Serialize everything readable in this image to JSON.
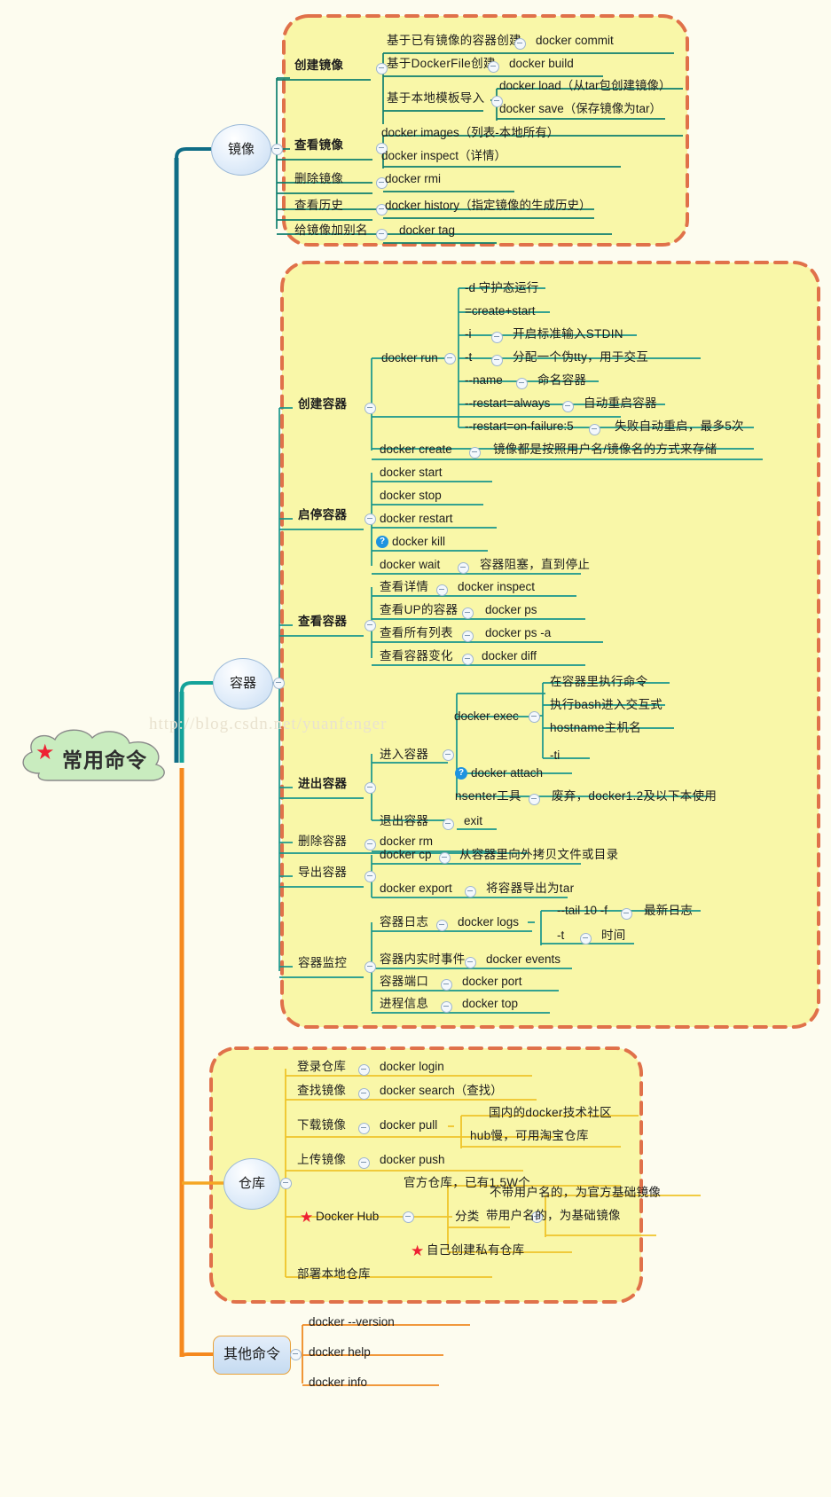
{
  "watermark": "http://blog.csdn.net/yuanfenger",
  "colors": {
    "canvas_bg": "#fdfcef",
    "group_fill": "#f9f7a8",
    "group_outline": "#e0714a",
    "branch_images": "#0f6d86",
    "branch_containers": "#14a39a",
    "branch_repo": "#f5a623",
    "branch_other": "#f5891e",
    "line_images": "#0f7f6f",
    "line_repo": "#efc42a",
    "line_other": "#ef8a22",
    "star": "#ee2233",
    "note_marker": "#1e93e0",
    "ellipse_fill": "#d5e6f7"
  },
  "root": {
    "label": "常用命令",
    "icon": "star-icon",
    "shape": "cloud"
  },
  "branches": [
    {
      "id": "images",
      "label": "镜像",
      "shape": "circle",
      "children": [
        {
          "label": "创建镜像",
          "bold": true,
          "children": [
            {
              "label": "基于已有镜像的容器创建",
              "value": "docker commit"
            },
            {
              "label": "基于DockerFile创建",
              "value": "docker build"
            },
            {
              "label": "基于本地模板导入",
              "children": [
                {
                  "label": "docker load（从tar包创建镜像）"
                },
                {
                  "label": "docker save（保存镜像为tar）"
                }
              ]
            }
          ]
        },
        {
          "label": "查看镜像",
          "children": [
            {
              "label": "docker images（列表-本地所有）"
            },
            {
              "label": "docker inspect（详情）"
            }
          ]
        },
        {
          "label": "删除镜像",
          "value": "docker rmi"
        },
        {
          "label": "查看历史",
          "value": "docker history（指定镜像的生成历史）"
        },
        {
          "label": "给镜像加别名",
          "value": "docker tag"
        }
      ]
    },
    {
      "id": "containers",
      "label": "容器",
      "shape": "circle",
      "children": [
        {
          "label": "创建容器",
          "bold": true,
          "children": [
            {
              "label": "docker run",
              "children": [
                {
                  "label": "-d 守护态运行"
                },
                {
                  "label": "=create+start"
                },
                {
                  "label": "-i",
                  "value": "开启标准输入STDIN"
                },
                {
                  "label": "-t",
                  "value": "分配一个伪tty，用于交互"
                },
                {
                  "label": "--name",
                  "value": "命名容器"
                },
                {
                  "label": "--restart=always",
                  "value": "自动重启容器"
                },
                {
                  "label": "--restart=on-failure:5",
                  "value": "失败自动重启，最多5次"
                }
              ]
            },
            {
              "label": "docker create",
              "value": "镜像都是按照用户名/镜像名的方式来存储"
            }
          ]
        },
        {
          "label": "启停容器",
          "bold": true,
          "children": [
            {
              "label": "docker start"
            },
            {
              "label": "docker stop"
            },
            {
              "label": "docker restart"
            },
            {
              "label": "docker kill",
              "marker": "question-marker"
            },
            {
              "label": "docker wait",
              "value": "容器阻塞，直到停止"
            }
          ]
        },
        {
          "label": "查看容器",
          "bold": true,
          "children": [
            {
              "label": "查看详情",
              "value": "docker inspect"
            },
            {
              "label": "查看UP的容器",
              "value": "docker ps"
            },
            {
              "label": "查看所有列表",
              "value": "docker ps -a"
            },
            {
              "label": "查看容器变化",
              "value": "docker diff"
            }
          ]
        },
        {
          "label": "进出容器",
          "bold": true,
          "children": [
            {
              "label": "进入容器",
              "children": [
                {
                  "label": "docker exec",
                  "children": [
                    {
                      "label": "在容器里执行命令"
                    },
                    {
                      "label": "执行bash进入交互式"
                    },
                    {
                      "label": "hostname主机名"
                    },
                    {
                      "label": "-ti"
                    }
                  ]
                },
                {
                  "label": "docker attach",
                  "marker": "question-marker"
                },
                {
                  "label": "nsenter工具",
                  "value": "废弃，docker1.2及以下本使用"
                }
              ]
            },
            {
              "label": "退出容器",
              "value": "exit"
            }
          ]
        },
        {
          "label": "删除容器",
          "value": "docker rm"
        },
        {
          "label": "导出容器",
          "children": [
            {
              "label": "docker cp",
              "value": "从容器里向外拷贝文件或目录"
            },
            {
              "label": "docker export",
              "value": "将容器导出为tar"
            }
          ]
        },
        {
          "label": "容器监控",
          "children": [
            {
              "label": "容器日志",
              "value": "docker logs",
              "children": [
                {
                  "label": "--tail 10 -f",
                  "value": "最新日志"
                },
                {
                  "label": "-t",
                  "value": "时间"
                }
              ]
            },
            {
              "label": "容器内实时事件",
              "value": "docker events"
            },
            {
              "label": "容器端口",
              "value": "docker port"
            },
            {
              "label": "进程信息",
              "value": "docker top"
            }
          ]
        }
      ]
    },
    {
      "id": "repository",
      "label": "仓库",
      "shape": "circle",
      "children": [
        {
          "label": "登录仓库",
          "value": "docker login"
        },
        {
          "label": "查找镜像",
          "value": "docker search（查找）"
        },
        {
          "label": "下载镜像",
          "value": "docker pull",
          "children": [
            {
              "label": "国内的docker技术社区"
            },
            {
              "label": "hub慢，可用淘宝仓库"
            }
          ]
        },
        {
          "label": "上传镜像",
          "value": "docker push"
        },
        {
          "label": "Docker Hub",
          "icon": "star-icon",
          "children": [
            {
              "label": "官方仓库，已有1.5W个"
            },
            {
              "label": "分类",
              "children": [
                {
                  "label": "不带用户名的，为官方基础镜像"
                },
                {
                  "label": "带用户名的，为基础镜像"
                }
              ]
            },
            {
              "label": "自己创建私有仓库",
              "icon": "star-icon"
            }
          ]
        },
        {
          "label": "部署本地仓库"
        }
      ]
    },
    {
      "id": "other",
      "label": "其他命令",
      "shape": "rounded-box",
      "children": [
        {
          "label": "docker --version"
        },
        {
          "label": "docker help"
        },
        {
          "label": "docker info"
        }
      ]
    }
  ],
  "labels": {
    "images": {
      "branch": "镜像",
      "create": "创建镜像",
      "create_1_k": "基于已有镜像的容器创建",
      "create_1_v": "docker commit",
      "create_2_k": "基于DockerFile创建",
      "create_2_v": "docker build",
      "create_3_k": "基于本地模板导入",
      "create_3_c1": "docker load（从tar包创建镜像）",
      "create_3_c2": "docker save（保存镜像为tar）",
      "view": "查看镜像",
      "view_1": "docker images（列表-本地所有）",
      "view_2": "docker inspect（详情）",
      "del_k": "删除镜像",
      "del_v": "docker rmi",
      "hist_k": "查看历史",
      "hist_v": "docker history（指定镜像的生成历史）",
      "tag_k": "给镜像加别名",
      "tag_v": "docker tag"
    },
    "containers": {
      "branch": "容器",
      "create": "创建容器",
      "run": "docker run",
      "run_1": "-d 守护态运行",
      "run_2": "=create+start",
      "run_3_k": "-i",
      "run_3_v": "开启标准输入STDIN",
      "run_4_k": "-t",
      "run_4_v": "分配一个伪tty，用于交互",
      "run_5_k": "--name",
      "run_5_v": "命名容器",
      "run_6_k": "--restart=always",
      "run_6_v": "自动重启容器",
      "run_7_k": "--restart=on-failure:5",
      "run_7_v": "失败自动重启，最多5次",
      "create_cmd_k": "docker create",
      "create_cmd_v": "镜像都是按照用户名/镜像名的方式来存储",
      "startstop": "启停容器",
      "ss_1": "docker start",
      "ss_2": "docker stop",
      "ss_3": "docker restart",
      "ss_4": "docker kill",
      "ss_5_k": "docker wait",
      "ss_5_v": "容器阻塞，直到停止",
      "view": "查看容器",
      "v_1_k": "查看详情",
      "v_1_v": "docker inspect",
      "v_2_k": "查看UP的容器",
      "v_2_v": "docker ps",
      "v_3_k": "查看所有列表",
      "v_3_v": "docker ps -a",
      "v_4_k": "查看容器变化",
      "v_4_v": "docker diff",
      "inout": "进出容器",
      "enter": "进入容器",
      "exec": "docker exec",
      "exec_1": "在容器里执行命令",
      "exec_2": "执行bash进入交互式",
      "exec_3": "hostname主机名",
      "exec_4": "-ti",
      "attach": "docker attach",
      "nsenter_k": "nsenter工具",
      "nsenter_v": "废弃，docker1.2及以下本使用",
      "exit_k": "退出容器",
      "exit_v": "exit",
      "rm_k": "删除容器",
      "rm_v": "docker rm",
      "export": "导出容器",
      "cp_k": "docker cp",
      "cp_v": "从容器里向外拷贝文件或目录",
      "exp_k": "docker export",
      "exp_v": "将容器导出为tar",
      "monitor": "容器监控",
      "logs_k": "容器日志",
      "logs_v": "docker logs",
      "tail_k": "--tail 10 -f",
      "tail_v": "最新日志",
      "t_k": "-t",
      "t_v": "时间",
      "events_k": "容器内实时事件",
      "events_v": "docker events",
      "port_k": "容器端口",
      "port_v": "docker port",
      "top_k": "进程信息",
      "top_v": "docker top"
    },
    "repository": {
      "branch": "仓库",
      "login_k": "登录仓库",
      "login_v": "docker login",
      "search_k": "查找镜像",
      "search_v": "docker search（查找）",
      "pull_k": "下载镜像",
      "pull_v": "docker pull",
      "pull_c1": "国内的docker技术社区",
      "pull_c2": "hub慢，可用淘宝仓库",
      "push_k": "上传镜像",
      "push_v": "docker push",
      "hub": "Docker Hub",
      "hub_1": "官方仓库，已有1.5W个",
      "hub_2": "分类",
      "hub_2_1": "不带用户名的，为官方基础镜像",
      "hub_2_2": "带用户名的，为基础镜像",
      "hub_3": "自己创建私有仓库",
      "local": "部署本地仓库"
    },
    "other": {
      "branch": "其他命令",
      "o_1": "docker --version",
      "o_2": "docker help",
      "o_3": "docker info"
    }
  }
}
